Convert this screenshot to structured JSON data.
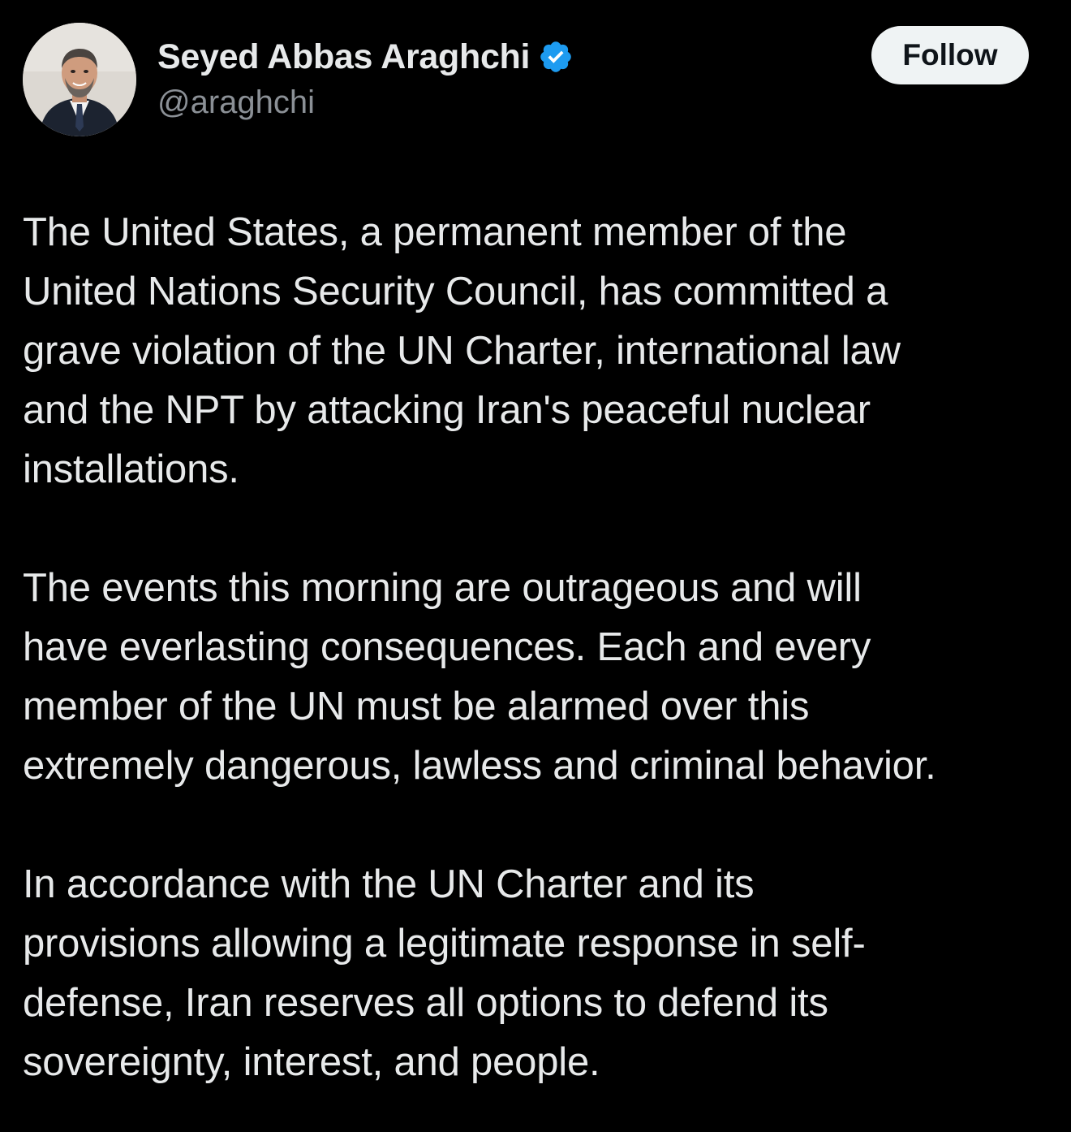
{
  "author": {
    "display_name": "Seyed Abbas Araghchi",
    "handle": "@araghchi",
    "verified_icon": "verified-badge-icon",
    "avatar": "profile-photo"
  },
  "actions": {
    "follow_label": "Follow"
  },
  "tweet": {
    "paragraphs": [
      "The United States, a permanent member of the\nUnited Nations Security Council, has committed a\ngrave violation of the UN Charter, international law\nand the NPT by attacking Iran's peaceful nuclear\ninstallations.",
      "The events this morning are outrageous and will\nhave everlasting consequences. Each and every\nmember of the UN must be alarmed over this\nextremely dangerous, lawless and criminal behavior.",
      "In accordance with the UN Charter and its\nprovisions allowing a legitimate response in self-\ndefense, Iran reserves all options to defend its\nsovereignty, interest, and people."
    ]
  },
  "colors": {
    "background": "#000000",
    "text": "#e7e9ea",
    "secondary_text": "#8b9096",
    "verified_blue": "#1d9bf0",
    "button_bg": "#eff3f4",
    "button_text": "#0f1419"
  }
}
